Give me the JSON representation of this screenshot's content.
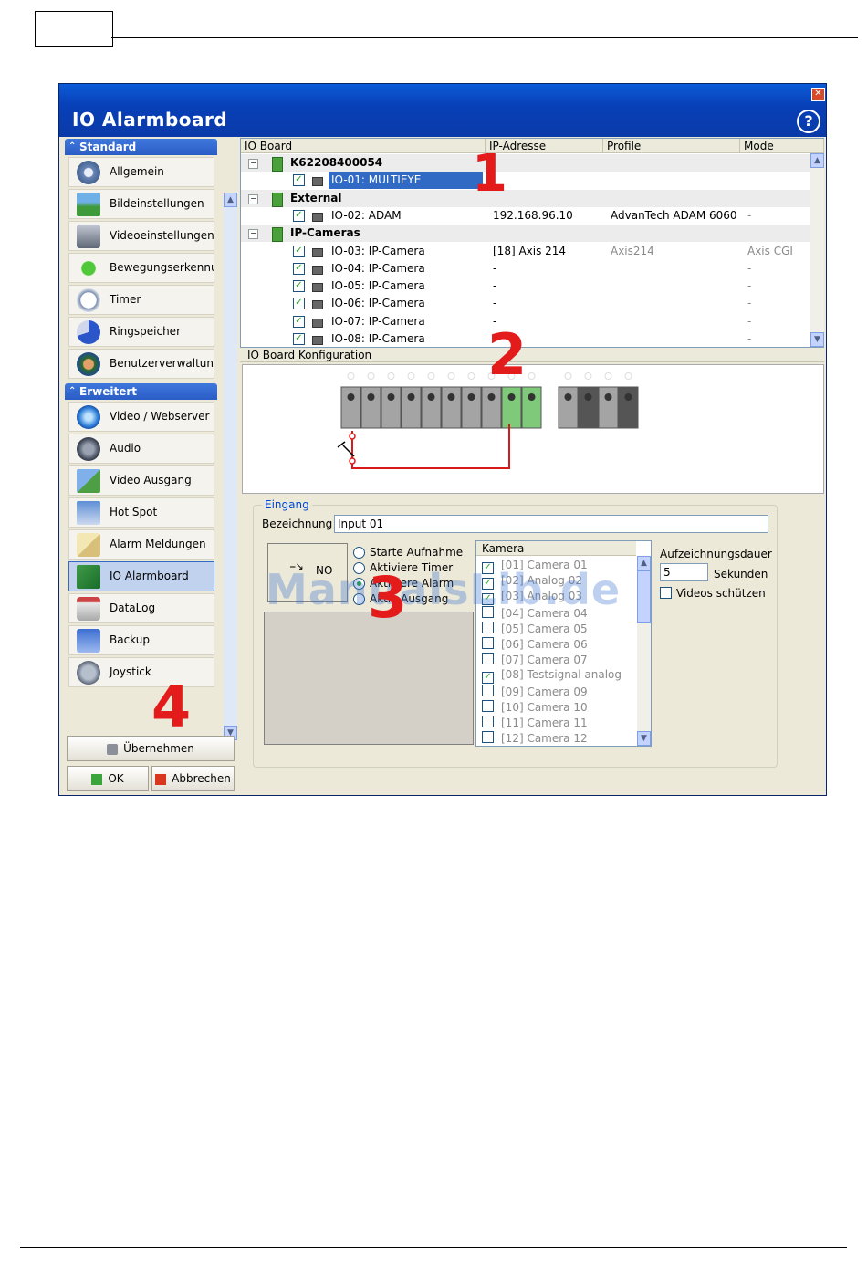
{
  "window": {
    "title": "IO Alarmboard",
    "close_glyph": "✕",
    "help_glyph": "?"
  },
  "sidebar": {
    "groups": [
      {
        "label": "Standard",
        "items": [
          "Allgemein",
          "Bildeinstellungen",
          "Videoeinstellungen",
          "Bewegungserkennung",
          "Timer",
          "Ringspeicher",
          "Benutzerverwaltung"
        ]
      },
      {
        "label": "Erweitert",
        "items": [
          "Video / Webserver",
          "Audio",
          "Video Ausgang",
          "Hot Spot",
          "Alarm Meldungen",
          "IO Alarmboard",
          "DataLog",
          "Backup",
          "Joystick"
        ]
      }
    ],
    "selected_item": "IO Alarmboard",
    "buttons": {
      "apply": "Übernehmen",
      "ok": "OK",
      "cancel": "Abbrechen"
    }
  },
  "tree": {
    "columns": [
      "IO Board",
      "IP-Adresse",
      "Profile",
      "Mode"
    ],
    "rows": [
      {
        "type": "group",
        "name": "K62208400054",
        "ip": "",
        "profile": "",
        "mode": ""
      },
      {
        "type": "item",
        "name": "IO-01: MULTIEYE",
        "ip": "",
        "profile": "",
        "mode": "",
        "selected": true
      },
      {
        "type": "group",
        "name": "External",
        "ip": "",
        "profile": "",
        "mode": ""
      },
      {
        "type": "item",
        "name": "IO-02: ADAM",
        "ip": "192.168.96.10",
        "profile": "AdvanTech ADAM 6060",
        "mode": "-"
      },
      {
        "type": "group",
        "name": "IP-Cameras",
        "ip": "",
        "profile": "",
        "mode": ""
      },
      {
        "type": "item",
        "name": "IO-03: IP-Camera",
        "ip": "[18] Axis 214",
        "profile": "Axis214",
        "mode": "Axis CGI"
      },
      {
        "type": "item",
        "name": "IO-04: IP-Camera",
        "ip": "-",
        "profile": "",
        "mode": "-"
      },
      {
        "type": "item",
        "name": "IO-05: IP-Camera",
        "ip": "-",
        "profile": "",
        "mode": "-"
      },
      {
        "type": "item",
        "name": "IO-06: IP-Camera",
        "ip": "-",
        "profile": "",
        "mode": "-"
      },
      {
        "type": "item",
        "name": "IO-07: IP-Camera",
        "ip": "-",
        "profile": "",
        "mode": "-"
      },
      {
        "type": "item",
        "name": "IO-08: IP-Camera",
        "ip": "-",
        "profile": "",
        "mode": "-"
      }
    ]
  },
  "config": {
    "header": "IO Board Konfiguration"
  },
  "eingang": {
    "legend": "Eingang",
    "bezeichnung_label": "Bezeichnung",
    "bezeichnung_value": "Input 01",
    "contact_label": "NO",
    "radios": [
      "Starte Aufnahme",
      "Aktiviere Timer",
      "Aktiviere Alarm",
      "Aktiv Ausgang"
    ],
    "radio_selected": 2,
    "kamera_header": "Kamera",
    "cameras": [
      {
        "label": "[01] Camera 01",
        "checked": true
      },
      {
        "label": "[02] Analog 02",
        "checked": true
      },
      {
        "label": "[03] Analog 03",
        "checked": true
      },
      {
        "label": "[04] Camera 04",
        "checked": false
      },
      {
        "label": "[05] Camera 05",
        "checked": false
      },
      {
        "label": "[06] Camera 06",
        "checked": false
      },
      {
        "label": "[07] Camera 07",
        "checked": false
      },
      {
        "label": "[08] Testsignal analog",
        "checked": true
      },
      {
        "label": "[09] Camera 09",
        "checked": false
      },
      {
        "label": "[10] Camera 10",
        "checked": false
      },
      {
        "label": "[11] Camera 11",
        "checked": false
      },
      {
        "label": "[12] Camera 12",
        "checked": false
      }
    ],
    "aufzeichnungsdauer_label": "Aufzeichnungsdauer",
    "dauer_value": "5",
    "sekunden_label": "Sekunden",
    "videos_schuetzen_label": "Videos schützen"
  },
  "annotations": [
    "1",
    "2",
    "3",
    "4"
  ],
  "watermark": "ManualsLib.de",
  "colors": {
    "accent": "#316ac5",
    "titlebar": "#0840b8",
    "annotation": "#e41b1b",
    "terminal_green": "#7fc97a",
    "wire": "#d91a1a"
  }
}
